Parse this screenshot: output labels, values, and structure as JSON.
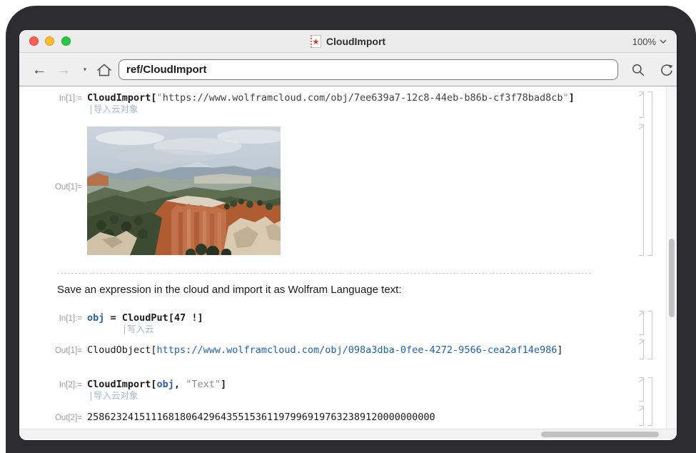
{
  "window": {
    "title": "CloudImport",
    "zoom_level": "100%"
  },
  "navbar": {
    "address": "ref/CloudImport"
  },
  "notebook": {
    "group1": {
      "in_label": "In[1]:=",
      "code": {
        "func": "CloudImport",
        "open": "[",
        "quote": "\"",
        "url": "https://www.wolframcloud.com/obj/7ee639a7-12c8-44eb-b86b-cf3f78bad8cb",
        "close": "]"
      },
      "annotation": "导入云对象",
      "out_label": "Out[1]=",
      "output_image": "bryce-canyon-landscape-photo"
    },
    "section_text": "Save an expression in the cloud and import it as Wolfram Language text:",
    "group2": {
      "in_label": "In[1]:=",
      "code": {
        "obj": "obj",
        "eq": " = ",
        "func": "CloudPut",
        "args": "[47 !]"
      },
      "annotation": "写入云",
      "out_label": "Out[1]=",
      "out": {
        "head": "CloudObject",
        "open": "[",
        "link": "https://www.wolframcloud.com/obj/098a3dba-0fee-4272-9566-cea2af14e986",
        "close": "]"
      }
    },
    "group3": {
      "in_label": "In[2]:=",
      "code": {
        "func": "CloudImport",
        "open": "[",
        "obj": "obj",
        "comma": ", ",
        "string": "\"Text\"",
        "close": "]"
      },
      "annotation": "导入云对象",
      "out_label": "Out[2]=",
      "out_value": "258623241511168180642964355153611979969197632389120000000000"
    }
  },
  "colors": {
    "traffic_red": "#ff5f57",
    "traffic_yellow": "#febc2e",
    "traffic_green": "#28c840",
    "symbol_blue": "#2a5fa5",
    "link_blue": "#1f62a8",
    "annotation_blue": "#a4b9cc",
    "frame_dark": "#2d2d2f"
  }
}
